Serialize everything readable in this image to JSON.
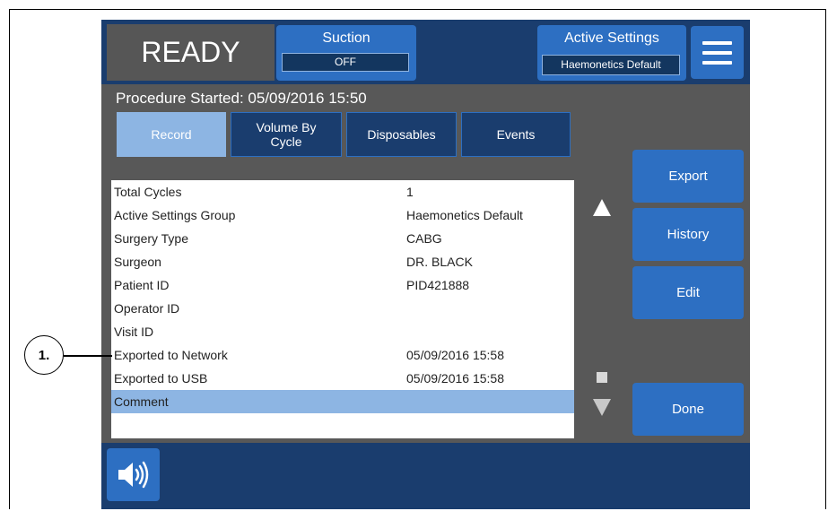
{
  "status": {
    "state": "READY"
  },
  "suction": {
    "label": "Suction",
    "value": "OFF"
  },
  "active_settings": {
    "label": "Active Settings",
    "value": "Haemonetics Default"
  },
  "procedure": {
    "title": "Procedure Started: 05/09/2016 15:50"
  },
  "tabs": [
    {
      "label": "Record",
      "selected": true
    },
    {
      "label": "Volume By Cycle",
      "selected": false
    },
    {
      "label": "Disposables",
      "selected": false
    },
    {
      "label": "Events",
      "selected": false
    }
  ],
  "record_rows": [
    {
      "field": "Total Cycles",
      "value": "1"
    },
    {
      "field": "Active Settings Group",
      "value": "Haemonetics Default"
    },
    {
      "field": "Surgery Type",
      "value": "CABG"
    },
    {
      "field": "Surgeon",
      "value": "DR. BLACK"
    },
    {
      "field": "Patient ID",
      "value": "PID421888"
    },
    {
      "field": "Operator ID",
      "value": ""
    },
    {
      "field": "Visit ID",
      "value": ""
    },
    {
      "field": "Exported to Network",
      "value": "05/09/2016 15:58"
    },
    {
      "field": "Exported to USB",
      "value": "05/09/2016 15:58"
    },
    {
      "field": "Comment",
      "value": "",
      "highlighted": true
    }
  ],
  "side_buttons": {
    "export": "Export",
    "history": "History",
    "edit": "Edit",
    "done": "Done"
  },
  "callout": {
    "label": "1."
  },
  "icons": {
    "menu": "hamburger-menu-icon",
    "scroll_up": "triangle-up-icon",
    "scroll_down": "triangle-down-icon",
    "speaker": "speaker-volume-icon"
  },
  "colors": {
    "bar_navy": "#1a3d6e",
    "button_blue": "#2d6fc2",
    "selected_blue": "#8db5e3",
    "panel_gray": "#585858"
  }
}
